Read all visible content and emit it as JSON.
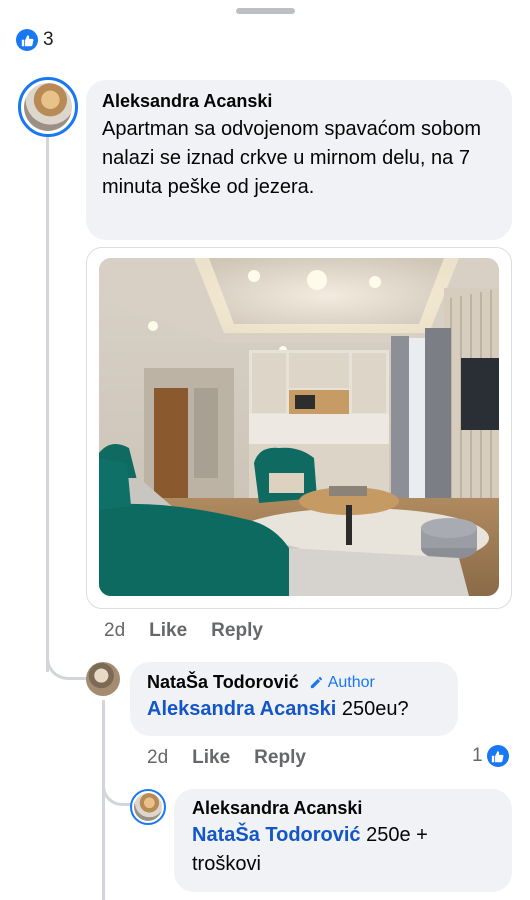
{
  "reaction": {
    "icon": "like-icon",
    "count": "3"
  },
  "comments": [
    {
      "author": "Aleksandra Acanski",
      "text": "Apartman sa odvojenom spavaćom sobom nalazi se iznad crkve u mirnom delu, na 7 minuta peške od jezera.",
      "time": "2d",
      "like_label": "Like",
      "reply_label": "Reply",
      "attachment": "photo"
    },
    {
      "author": "NataŠa Todorović",
      "badge": "Author",
      "mention": "Aleksandra Acanski",
      "text": "250eu?",
      "time": "2d",
      "like_label": "Like",
      "reply_label": "Reply",
      "reaction_count": "1"
    },
    {
      "author": "Aleksandra Acanski",
      "mention": "NataŠa Todorović",
      "text": "250e + troškovi"
    }
  ],
  "colors": {
    "accent": "#1877f2",
    "bubble": "#f0f2f5",
    "mention": "#1456c8",
    "muted": "#65676b"
  }
}
